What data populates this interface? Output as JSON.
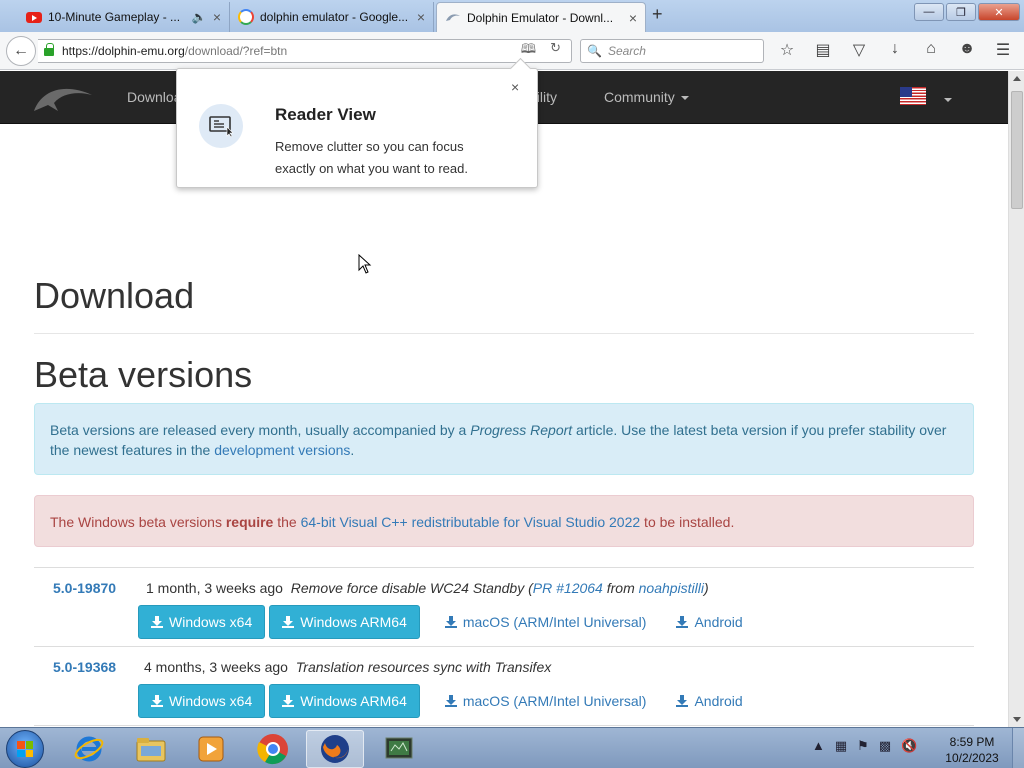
{
  "browser": {
    "tabs": [
      {
        "title": "10-Minute Gameplay - ...",
        "icon": "youtube-icon",
        "active": false
      },
      {
        "title": "dolphin emulator - Google...",
        "icon": "google-icon",
        "active": false
      },
      {
        "title": "Dolphin Emulator - Downl...",
        "icon": "dolphin-icon",
        "active": true
      }
    ],
    "url_host": "https://dolphin-emu.org",
    "url_path": "/download/?ref=btn",
    "search_placeholder": "Search"
  },
  "site": {
    "nav": {
      "download": "Downloa",
      "compat": "tibility",
      "community": "Community"
    },
    "page_title": "Download",
    "section_title": "Beta versions",
    "info_alert": {
      "part1": "Beta versions are released every month, usually accompanied by a ",
      "progress_report": "Progress Report",
      "part2": " article. Use the latest beta version if you prefer stability over the newest features in the ",
      "link": "development versions",
      "part3": "."
    },
    "danger_alert": {
      "part1": "The Windows beta versions ",
      "bold": "require",
      "part2": " the ",
      "link": "64-bit Visual C++ redistributable for Visual Studio 2022",
      "part3": " to be installed."
    },
    "releases": [
      {
        "version": "5.0-19870",
        "age": "1 month, 3 weeks ago",
        "message": "Remove force disable WC24 Standby",
        "pr_open": " (",
        "pr": "PR #12064",
        "from": " from ",
        "author": "noahpistilli",
        "pr_close": ")",
        "win_x64": "Windows x64",
        "win_arm": "Windows ARM64",
        "macos": "macOS (ARM/Intel Universal)",
        "android": "Android"
      },
      {
        "version": "5.0-19368",
        "age": "4 months, 3 weeks ago",
        "message": "Translation resources sync with Transifex",
        "win_x64": "Windows x64",
        "win_arm": "Windows ARM64",
        "macos": "macOS (ARM/Intel Universal)",
        "android": "Android"
      }
    ]
  },
  "popup": {
    "title": "Reader View",
    "body": "Remove clutter so you can focus exactly on what you want to read.",
    "close": "×"
  },
  "taskbar": {
    "apps": [
      "ie-icon",
      "explorer-icon",
      "media-player-icon",
      "chrome-icon",
      "firefox-icon",
      "app-icon"
    ],
    "time": "8:59 PM",
    "date": "10/2/2023"
  },
  "colors": {
    "link": "#337ab7",
    "info_bg": "#d9edf7",
    "danger_bg": "#f2dede",
    "btn_info": "#31b0d5",
    "nav_bg": "#252525"
  }
}
